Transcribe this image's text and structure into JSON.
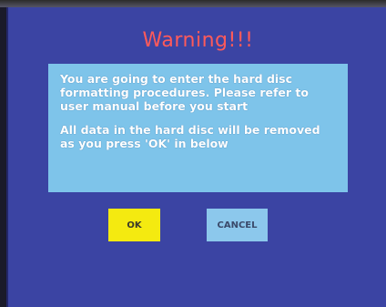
{
  "dialog": {
    "title": "Warning!!!",
    "message_lines": [
      " You are going to enter the hard disc",
      "formatting procedures. Please refer to",
      "user manual before you start",
      " All data in the hard disc will be removed",
      "as you press 'OK' in below"
    ],
    "ok_label": "OK",
    "cancel_label": "CANCEL"
  },
  "colors": {
    "background": "#3b44a3",
    "title": "#ff5a5a",
    "message_box": "#7ec4ea",
    "ok_button": "#f4ea10",
    "cancel_button": "#8cc8ec"
  }
}
